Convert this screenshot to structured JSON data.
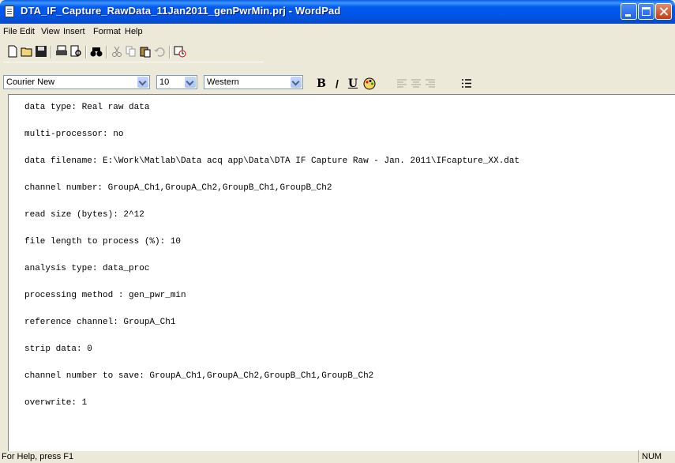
{
  "window": {
    "title": "DTA_IF_Capture_RawData_11Jan2011_genPwrMin.prj - WordPad"
  },
  "menu": [
    "File",
    "Edit",
    "View",
    "Insert",
    "Format",
    "Help"
  ],
  "toolbar_icons": [
    "new-document-icon",
    "open-folder-icon",
    "save-disk-icon",
    "print-icon",
    "print-preview-icon",
    "find-binoculars-icon",
    "cut-scissors-icon",
    "copy-icon",
    "paste-icon",
    "undo-icon",
    "insert-datetime-icon"
  ],
  "format": {
    "font": "Courier New",
    "size": "10",
    "script": "Western",
    "bold": "B",
    "italic": "/",
    "underline": "U"
  },
  "document": {
    "lines": [
      "data type: Real raw data",
      "multi-processor: no",
      "data filename: E:\\Work\\Matlab\\Data acq app\\Data\\DTA IF Capture Raw - Jan. 2011\\IFcapture_XX.dat",
      "channel number: GroupA_Ch1,GroupA_Ch2,GroupB_Ch1,GroupB_Ch2",
      "read size (bytes): 2^12",
      "file length to process (%): 10",
      "analysis type: data_proc",
      "processing method : gen_pwr_min",
      "reference channel: GroupA_Ch1",
      "strip data: 0",
      "channel number to save: GroupA_Ch1,GroupA_Ch2,GroupB_Ch1,GroupB_Ch2",
      "overwrite: 1"
    ]
  },
  "status": {
    "help": "For Help, press F1",
    "num": "NUM"
  },
  "colors": {
    "titlebar": "#0055E5",
    "chrome": "#ECE9D8",
    "editor_bg": "#FFFFFF"
  }
}
